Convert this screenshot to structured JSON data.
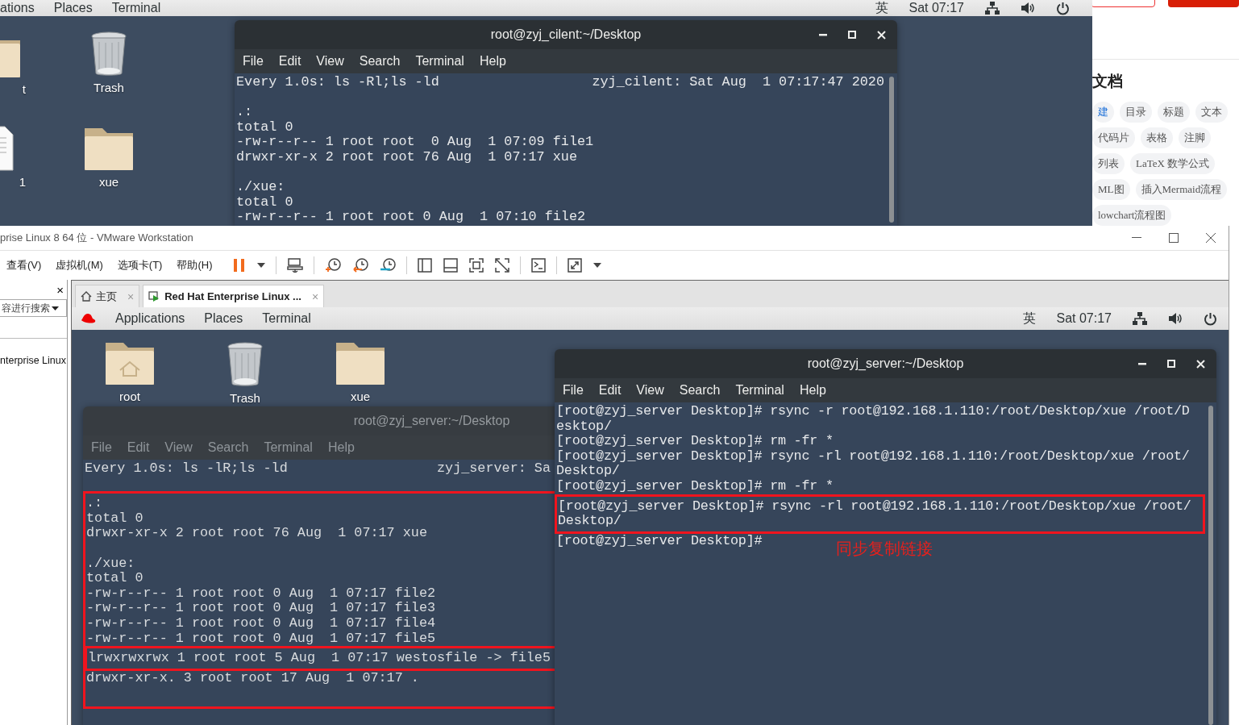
{
  "top_desktop": {
    "top_bar": {
      "menus": [
        "ations",
        "Places",
        "Terminal"
      ],
      "input_method": "英",
      "clock": "Sat 07:17"
    },
    "icons": [
      {
        "label": "t",
        "kind": "folder"
      },
      {
        "label": "Trash",
        "kind": "trash"
      },
      {
        "label": "1",
        "kind": "document"
      },
      {
        "label": "xue",
        "kind": "folder"
      }
    ],
    "terminal": {
      "title": "root@zyj_cilent:~/Desktop",
      "active": true,
      "menu": [
        "File",
        "Edit",
        "View",
        "Search",
        "Terminal",
        "Help"
      ],
      "header": {
        "command": "Every 1.0s: ls -Rl;ls -ld",
        "host_time": "zyj_cilent: Sat Aug  1 07:17:47 2020"
      },
      "blocks": [
        [
          ".:",
          "total 0",
          "-rw-r--r-- 1 root root  0 Aug  1 07:09 file1",
          "drwxr-xr-x 2 root root 76 Aug  1 07:17 xue"
        ],
        [
          "./xue:",
          "total 0",
          "-rw-r--r-- 1 root root 0 Aug  1 07:10 file2"
        ]
      ]
    }
  },
  "browser_panel": {
    "heading": "文档",
    "chip_rows": [
      [
        {
          "label": "建",
          "kind": "link"
        },
        {
          "label": "目录",
          "kind": "tag"
        },
        {
          "label": "标题",
          "kind": "tag"
        },
        {
          "label": "文本",
          "kind": "tag"
        }
      ],
      [
        {
          "label": "代码片",
          "kind": "tag"
        },
        {
          "label": "表格",
          "kind": "tag"
        },
        {
          "label": "注脚",
          "kind": "tag"
        }
      ],
      [
        {
          "label": "列表",
          "kind": "tag"
        },
        {
          "label": "LaTeX 数学公式",
          "kind": "tag"
        }
      ],
      [
        {
          "label": "ML图",
          "kind": "tag"
        },
        {
          "label": "插入Mermaid流程",
          "kind": "tag"
        }
      ],
      [
        {
          "label": "lowchart流程图",
          "kind": "tag"
        }
      ]
    ]
  },
  "vmware": {
    "title": "prise Linux 8 64 位 - VMware Workstation",
    "menus": [
      "查看(V)",
      "虚拟机(M)",
      "选项卡(T)",
      "帮助(H)"
    ],
    "library": {
      "close": "×",
      "search_placeholder": "容进行搜索",
      "items": [
        "nterprise Linux"
      ]
    },
    "tabs": [
      {
        "label": "主页",
        "kind": "home",
        "selected": false,
        "close": "×"
      },
      {
        "label": "Red Hat Enterprise Linux ...",
        "kind": "vm",
        "selected": true,
        "close": "×"
      }
    ],
    "guest": {
      "top_bar": {
        "menus": [
          "Applications",
          "Places",
          "Terminal"
        ],
        "input_method": "英",
        "clock": "Sat 07:17"
      },
      "icons": [
        {
          "label": "root",
          "kind": "home"
        },
        {
          "label": "Trash",
          "kind": "trash"
        },
        {
          "label": "xue",
          "kind": "folder"
        }
      ],
      "back_terminal": {
        "title": "root@zyj_server:~/Desktop",
        "active": false,
        "menu": [
          "File",
          "Edit",
          "View",
          "Search",
          "Terminal",
          "Help"
        ],
        "header": {
          "command": "Every 1.0s: ls -lR;ls -ld",
          "host_time": "zyj_server: Sa"
        },
        "blocks": [
          [
            ".:",
            "total 0",
            "drwxr-xr-x 2 root root 76 Aug  1 07:17 xue"
          ],
          [
            "./xue:",
            "total 0",
            "-rw-r--r-- 1 root root 0 Aug  1 07:17 file2",
            "-rw-r--r-- 1 root root 0 Aug  1 07:17 file3",
            "-rw-r--r-- 1 root root 0 Aug  1 07:17 file4",
            "-rw-r--r-- 1 root root 0 Aug  1 07:17 file5",
            "lrwxrwxrwx 1 root root 5 Aug  1 07:17 westosfile -> file5",
            "drwxr-xr-x. 3 root root 17 Aug  1 07:17 ."
          ]
        ]
      },
      "front_terminal": {
        "title": "root@zyj_server:~/Desktop",
        "active": true,
        "menu": [
          "File",
          "Edit",
          "View",
          "Search",
          "Terminal",
          "Help"
        ],
        "blocks": [
          [
            "[root@zyj_server Desktop]# rsync -r root@192.168.1.110:/root/Desktop/xue /root/D",
            "esktop/",
            "[root@zyj_server Desktop]# rm -fr *",
            "[root@zyj_server Desktop]# rsync -rl root@192.168.1.110:/root/Desktop/xue /root/",
            "Desktop/",
            "[root@zyj_server Desktop]# rm -fr *",
            "[root@zyj_server Desktop]# rsync -rl root@192.168.1.110:/root/Desktop/xue /root/",
            "Desktop/",
            "[root@zyj_server Desktop]#"
          ]
        ]
      },
      "annotation": "同步复制链接"
    }
  }
}
